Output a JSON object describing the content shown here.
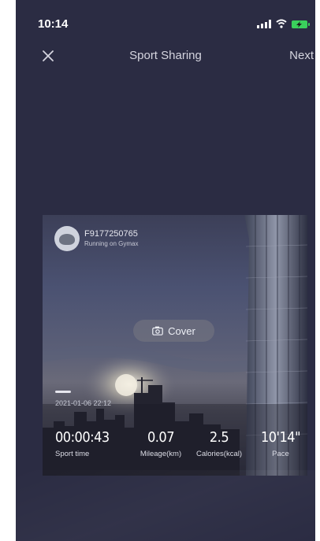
{
  "status_bar": {
    "time": "10:14",
    "signal_icon": "signal-icon",
    "wifi_icon": "wifi-icon",
    "battery_icon": "battery-charging-icon",
    "battery_color": "#3ad05c"
  },
  "nav": {
    "close_icon": "close-icon",
    "title": "Sport Sharing",
    "next_label": "Next"
  },
  "card": {
    "user_name": "F9177250765",
    "user_subtitle": "Running on Gymax",
    "cover_label": "Cover",
    "cover_icon": "camera-icon",
    "date": "2021-01-06 22:12",
    "stats": [
      {
        "value": "00:00:43",
        "label": "Sport time"
      },
      {
        "value": "0.07",
        "label": "Mileage(km)"
      },
      {
        "value": "2.5",
        "label": "Calories(kcal)"
      },
      {
        "value": "10'14\"",
        "label": "Pace"
      }
    ]
  },
  "colors": {
    "background": "#2b2c43",
    "text": "#d5d5df"
  }
}
